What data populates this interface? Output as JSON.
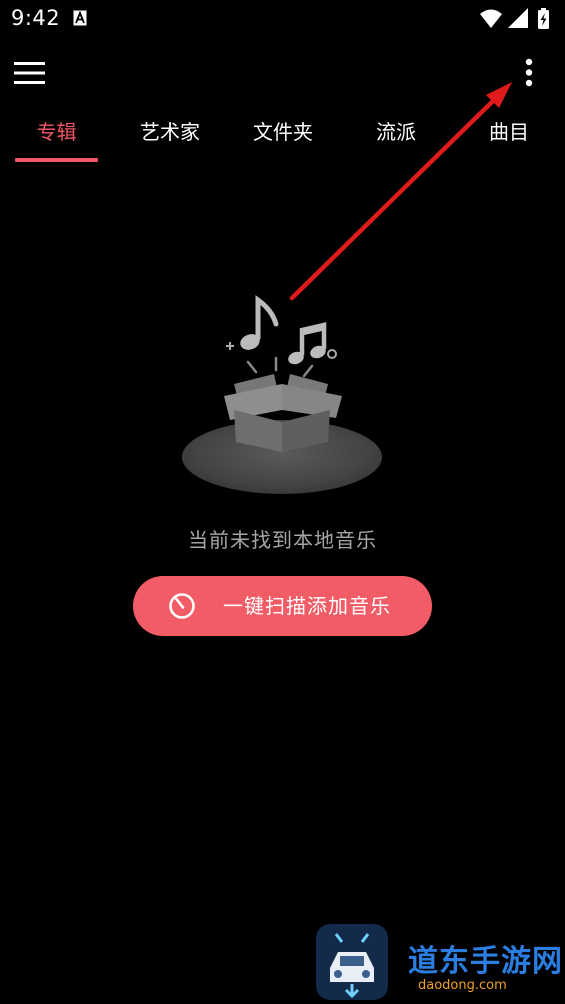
{
  "status_bar": {
    "time": "9:42",
    "icons": [
      "notification-a-icon",
      "wifi-icon",
      "signal-icon",
      "battery-charging-icon"
    ]
  },
  "toolbar": {
    "menu_icon": "hamburger-menu-icon",
    "more_icon": "more-vertical-icon"
  },
  "tabs": [
    {
      "label": "专辑",
      "active": true
    },
    {
      "label": "艺术家",
      "active": false
    },
    {
      "label": "文件夹",
      "active": false
    },
    {
      "label": "流派",
      "active": false
    },
    {
      "label": "曲目",
      "active": false
    }
  ],
  "empty_state": {
    "message": "当前未找到本地音乐",
    "illustration": "empty-music-box-icon"
  },
  "scan_button": {
    "label": "一键扫描添加音乐",
    "icon": "scan-timer-icon"
  },
  "annotation": {
    "icon": "red-arrow-icon"
  },
  "watermark": {
    "title": "道东手游网",
    "subtitle": "daodong.com"
  },
  "colors": {
    "accent": "#f25563",
    "button": "#f25c66",
    "background": "#000000",
    "muted_text": "#a6a6a6",
    "arrow": "#e01b1b"
  }
}
